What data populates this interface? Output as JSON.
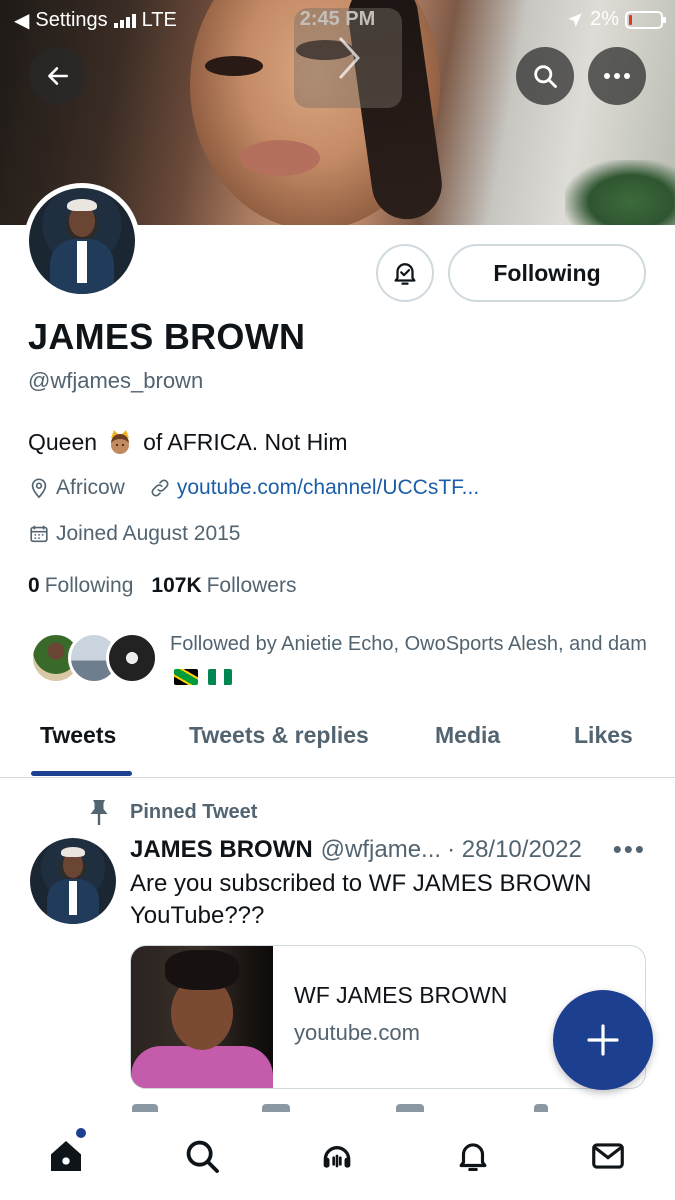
{
  "status_bar": {
    "back_app": "Settings",
    "network": "LTE",
    "time": "2:45 PM",
    "battery": "2%",
    "battery_color": "#e0342b"
  },
  "profile": {
    "name": "JAMES BROWN",
    "handle": "@wfjames_brown",
    "bio_start": "Queen",
    "bio_emoji": "crown-woman-emoji",
    "bio_end": "of AFRICA. Not Him",
    "location": "Africow",
    "website": "youtube.com/channel/UCCsTF...",
    "joined": "Joined August 2015",
    "following_count": "0",
    "following_label": "Following",
    "followers_count": "107K",
    "followers_label": "Followers",
    "followed_by": "Followed by Anietie Echo, OwoSports Alesh, and dam",
    "follow_button": "Following"
  },
  "tabs": [
    {
      "label": "Tweets",
      "active": true
    },
    {
      "label": "Tweets & replies",
      "active": false
    },
    {
      "label": "Media",
      "active": false
    },
    {
      "label": "Likes",
      "active": false
    }
  ],
  "pinned_tweet": {
    "pinned_label": "Pinned Tweet",
    "author_name": "JAMES BROWN",
    "author_handle": "@wfjame...",
    "date": "· 28/10/2022",
    "more": "•••",
    "text": "Are you subscribed to WF JAMES BROWN YouTube???",
    "card_title": "WF JAMES BROWN",
    "card_domain": "youtube.com"
  },
  "colors": {
    "accent": "#1d3f8f",
    "link": "#1d5ea8",
    "secondary_text": "#536471",
    "border": "#cfd9de"
  },
  "icons": {
    "back": "back-arrow-icon",
    "search": "search-icon",
    "more": "more-icon",
    "bell": "bell-icon",
    "location": "location-pin-icon",
    "link": "link-icon",
    "calendar": "calendar-icon",
    "pin": "pin-icon",
    "compose": "plus-icon",
    "nav": [
      "home-icon",
      "search-icon",
      "spaces-icon",
      "notifications-icon",
      "messages-icon"
    ]
  }
}
